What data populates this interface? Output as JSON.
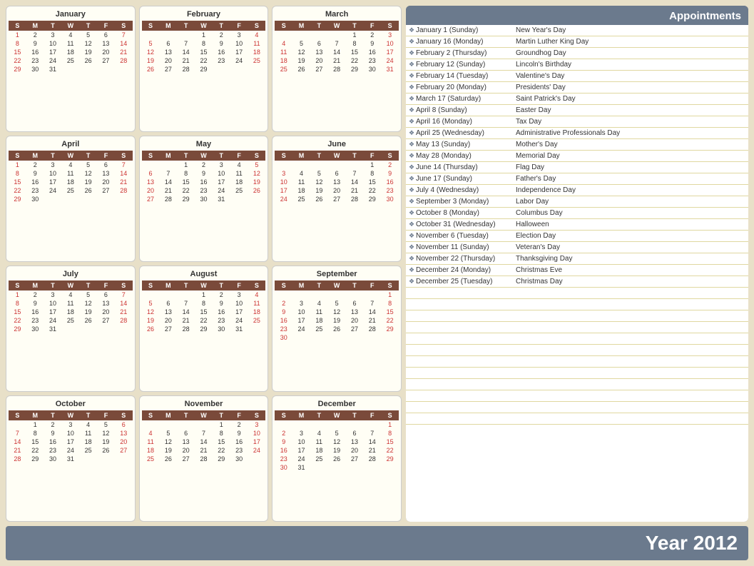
{
  "title": "Year 2012",
  "appointments_title": "Appointments",
  "footer_year": "Year 2012",
  "calendars": [
    {
      "name": "January",
      "days_header": [
        "S",
        "M",
        "T",
        "W",
        "T",
        "F",
        "S"
      ],
      "weeks": [
        [
          "1",
          "2",
          "3",
          "4",
          "5",
          "6",
          "7"
        ],
        [
          "8",
          "9",
          "10",
          "11",
          "12",
          "13",
          "14"
        ],
        [
          "15",
          "16",
          "17",
          "18",
          "19",
          "20",
          "21"
        ],
        [
          "22",
          "23",
          "24",
          "25",
          "26",
          "27",
          "28"
        ],
        [
          "29",
          "30",
          "31",
          "",
          "",
          "",
          ""
        ]
      ]
    },
    {
      "name": "February",
      "days_header": [
        "S",
        "M",
        "T",
        "W",
        "T",
        "F",
        "S"
      ],
      "weeks": [
        [
          "",
          "",
          "",
          "1",
          "2",
          "3",
          "4"
        ],
        [
          "5",
          "6",
          "7",
          "8",
          "9",
          "10",
          "11"
        ],
        [
          "12",
          "13",
          "14",
          "15",
          "16",
          "17",
          "18"
        ],
        [
          "19",
          "20",
          "21",
          "22",
          "23",
          "24",
          "25"
        ],
        [
          "26",
          "27",
          "28",
          "29",
          "",
          "",
          ""
        ]
      ]
    },
    {
      "name": "March",
      "days_header": [
        "S",
        "M",
        "T",
        "W",
        "T",
        "F",
        "S"
      ],
      "weeks": [
        [
          "",
          "",
          "",
          "",
          "1",
          "2",
          "3"
        ],
        [
          "4",
          "5",
          "6",
          "7",
          "8",
          "9",
          "10"
        ],
        [
          "11",
          "12",
          "13",
          "14",
          "15",
          "16",
          "17"
        ],
        [
          "18",
          "19",
          "20",
          "21",
          "22",
          "23",
          "24"
        ],
        [
          "25",
          "26",
          "27",
          "28",
          "29",
          "30",
          "31"
        ]
      ]
    },
    {
      "name": "April",
      "days_header": [
        "S",
        "M",
        "T",
        "W",
        "T",
        "F",
        "S"
      ],
      "weeks": [
        [
          "1",
          "2",
          "3",
          "4",
          "5",
          "6",
          "7"
        ],
        [
          "8",
          "9",
          "10",
          "11",
          "12",
          "13",
          "14"
        ],
        [
          "15",
          "16",
          "17",
          "18",
          "19",
          "20",
          "21"
        ],
        [
          "22",
          "23",
          "24",
          "25",
          "26",
          "27",
          "28"
        ],
        [
          "29",
          "30",
          "",
          "",
          "",
          "",
          ""
        ]
      ]
    },
    {
      "name": "May",
      "days_header": [
        "S",
        "M",
        "T",
        "W",
        "T",
        "F",
        "S"
      ],
      "weeks": [
        [
          "",
          "",
          "1",
          "2",
          "3",
          "4",
          "5"
        ],
        [
          "6",
          "7",
          "8",
          "9",
          "10",
          "11",
          "12"
        ],
        [
          "13",
          "14",
          "15",
          "16",
          "17",
          "18",
          "19"
        ],
        [
          "20",
          "21",
          "22",
          "23",
          "24",
          "25",
          "26"
        ],
        [
          "27",
          "28",
          "29",
          "30",
          "31",
          "",
          ""
        ]
      ]
    },
    {
      "name": "June",
      "days_header": [
        "S",
        "M",
        "T",
        "W",
        "T",
        "F",
        "S"
      ],
      "weeks": [
        [
          "",
          "",
          "",
          "",
          "",
          "1",
          "2"
        ],
        [
          "3",
          "4",
          "5",
          "6",
          "7",
          "8",
          "9"
        ],
        [
          "10",
          "11",
          "12",
          "13",
          "14",
          "15",
          "16"
        ],
        [
          "17",
          "18",
          "19",
          "20",
          "21",
          "22",
          "23"
        ],
        [
          "24",
          "25",
          "26",
          "27",
          "28",
          "29",
          "30"
        ]
      ]
    },
    {
      "name": "July",
      "days_header": [
        "S",
        "M",
        "T",
        "W",
        "T",
        "F",
        "S"
      ],
      "weeks": [
        [
          "1",
          "2",
          "3",
          "4",
          "5",
          "6",
          "7"
        ],
        [
          "8",
          "9",
          "10",
          "11",
          "12",
          "13",
          "14"
        ],
        [
          "15",
          "16",
          "17",
          "18",
          "19",
          "20",
          "21"
        ],
        [
          "22",
          "23",
          "24",
          "25",
          "26",
          "27",
          "28"
        ],
        [
          "29",
          "30",
          "31",
          "",
          "",
          "",
          ""
        ]
      ]
    },
    {
      "name": "August",
      "days_header": [
        "S",
        "M",
        "T",
        "W",
        "T",
        "F",
        "S"
      ],
      "weeks": [
        [
          "",
          "",
          "",
          "1",
          "2",
          "3",
          "4"
        ],
        [
          "5",
          "6",
          "7",
          "8",
          "9",
          "10",
          "11"
        ],
        [
          "12",
          "13",
          "14",
          "15",
          "16",
          "17",
          "18"
        ],
        [
          "19",
          "20",
          "21",
          "22",
          "23",
          "24",
          "25"
        ],
        [
          "26",
          "27",
          "28",
          "29",
          "30",
          "31",
          ""
        ]
      ]
    },
    {
      "name": "September",
      "days_header": [
        "S",
        "M",
        "T",
        "W",
        "T",
        "F",
        "S"
      ],
      "weeks": [
        [
          "",
          "",
          "",
          "",
          "",
          "",
          "1"
        ],
        [
          "2",
          "3",
          "4",
          "5",
          "6",
          "7",
          "8"
        ],
        [
          "9",
          "10",
          "11",
          "12",
          "13",
          "14",
          "15"
        ],
        [
          "16",
          "17",
          "18",
          "19",
          "20",
          "21",
          "22"
        ],
        [
          "23",
          "24",
          "25",
          "26",
          "27",
          "28",
          "29"
        ],
        [
          "30",
          "",
          "",
          "",
          "",
          "",
          ""
        ]
      ]
    },
    {
      "name": "October",
      "days_header": [
        "S",
        "M",
        "T",
        "W",
        "T",
        "F",
        "S"
      ],
      "weeks": [
        [
          "",
          "1",
          "2",
          "3",
          "4",
          "5",
          "6"
        ],
        [
          "7",
          "8",
          "9",
          "10",
          "11",
          "12",
          "13"
        ],
        [
          "14",
          "15",
          "16",
          "17",
          "18",
          "19",
          "20"
        ],
        [
          "21",
          "22",
          "23",
          "24",
          "25",
          "26",
          "27"
        ],
        [
          "28",
          "29",
          "30",
          "31",
          "",
          "",
          ""
        ]
      ]
    },
    {
      "name": "November",
      "days_header": [
        "S",
        "M",
        "T",
        "W",
        "T",
        "F",
        "S"
      ],
      "weeks": [
        [
          "",
          "",
          "",
          "",
          "1",
          "2",
          "3"
        ],
        [
          "4",
          "5",
          "6",
          "7",
          "8",
          "9",
          "10"
        ],
        [
          "11",
          "12",
          "13",
          "14",
          "15",
          "16",
          "17"
        ],
        [
          "18",
          "19",
          "20",
          "21",
          "22",
          "23",
          "24"
        ],
        [
          "25",
          "26",
          "27",
          "28",
          "29",
          "30",
          ""
        ]
      ]
    },
    {
      "name": "December",
      "days_header": [
        "S",
        "M",
        "T",
        "W",
        "T",
        "F",
        "S"
      ],
      "weeks": [
        [
          "",
          "",
          "",
          "",
          "",
          "",
          "1"
        ],
        [
          "2",
          "3",
          "4",
          "5",
          "6",
          "7",
          "8"
        ],
        [
          "9",
          "10",
          "11",
          "12",
          "13",
          "14",
          "15"
        ],
        [
          "16",
          "17",
          "18",
          "19",
          "20",
          "21",
          "22"
        ],
        [
          "23",
          "24",
          "25",
          "26",
          "27",
          "28",
          "29"
        ],
        [
          "30",
          "31",
          "",
          "",
          "",
          "",
          ""
        ]
      ]
    }
  ],
  "appointments": [
    {
      "date": "January 1 (Sunday)",
      "name": "New Year's Day"
    },
    {
      "date": "January 16 (Monday)",
      "name": "Martin Luther King Day"
    },
    {
      "date": "February 2 (Thursday)",
      "name": "Groundhog Day"
    },
    {
      "date": "February 12 (Sunday)",
      "name": "Lincoln's Birthday"
    },
    {
      "date": "February 14 (Tuesday)",
      "name": "Valentine's Day"
    },
    {
      "date": "February 20 (Monday)",
      "name": "Presidents' Day"
    },
    {
      "date": "March 17 (Saturday)",
      "name": "Saint Patrick's Day"
    },
    {
      "date": "April 8 (Sunday)",
      "name": "Easter Day"
    },
    {
      "date": "April 16 (Monday)",
      "name": "Tax Day"
    },
    {
      "date": "April 25 (Wednesday)",
      "name": "Administrative Professionals Day"
    },
    {
      "date": "May 13 (Sunday)",
      "name": "Mother's Day"
    },
    {
      "date": "May 28 (Monday)",
      "name": "Memorial Day"
    },
    {
      "date": "June 14 (Thursday)",
      "name": "Flag Day"
    },
    {
      "date": "June 17 (Sunday)",
      "name": "Father's Day"
    },
    {
      "date": "July 4 (Wednesday)",
      "name": "Independence Day"
    },
    {
      "date": "September 3 (Monday)",
      "name": "Labor Day"
    },
    {
      "date": "October 8 (Monday)",
      "name": "Columbus Day"
    },
    {
      "date": "October 31 (Wednesday)",
      "name": "Halloween"
    },
    {
      "date": "November 6 (Tuesday)",
      "name": "Election Day"
    },
    {
      "date": "November 11 (Sunday)",
      "name": "Veteran's Day"
    },
    {
      "date": "November 22 (Thursday)",
      "name": "Thanksgiving Day"
    },
    {
      "date": "December 24 (Monday)",
      "name": "Christmas Eve"
    },
    {
      "date": "December 25 (Tuesday)",
      "name": "Christmas Day"
    },
    {
      "date": "",
      "name": ""
    },
    {
      "date": "",
      "name": ""
    },
    {
      "date": "",
      "name": ""
    },
    {
      "date": "",
      "name": ""
    },
    {
      "date": "",
      "name": ""
    },
    {
      "date": "",
      "name": ""
    },
    {
      "date": "",
      "name": ""
    },
    {
      "date": "",
      "name": ""
    },
    {
      "date": "",
      "name": ""
    },
    {
      "date": "",
      "name": ""
    },
    {
      "date": "",
      "name": ""
    },
    {
      "date": "",
      "name": ""
    }
  ]
}
